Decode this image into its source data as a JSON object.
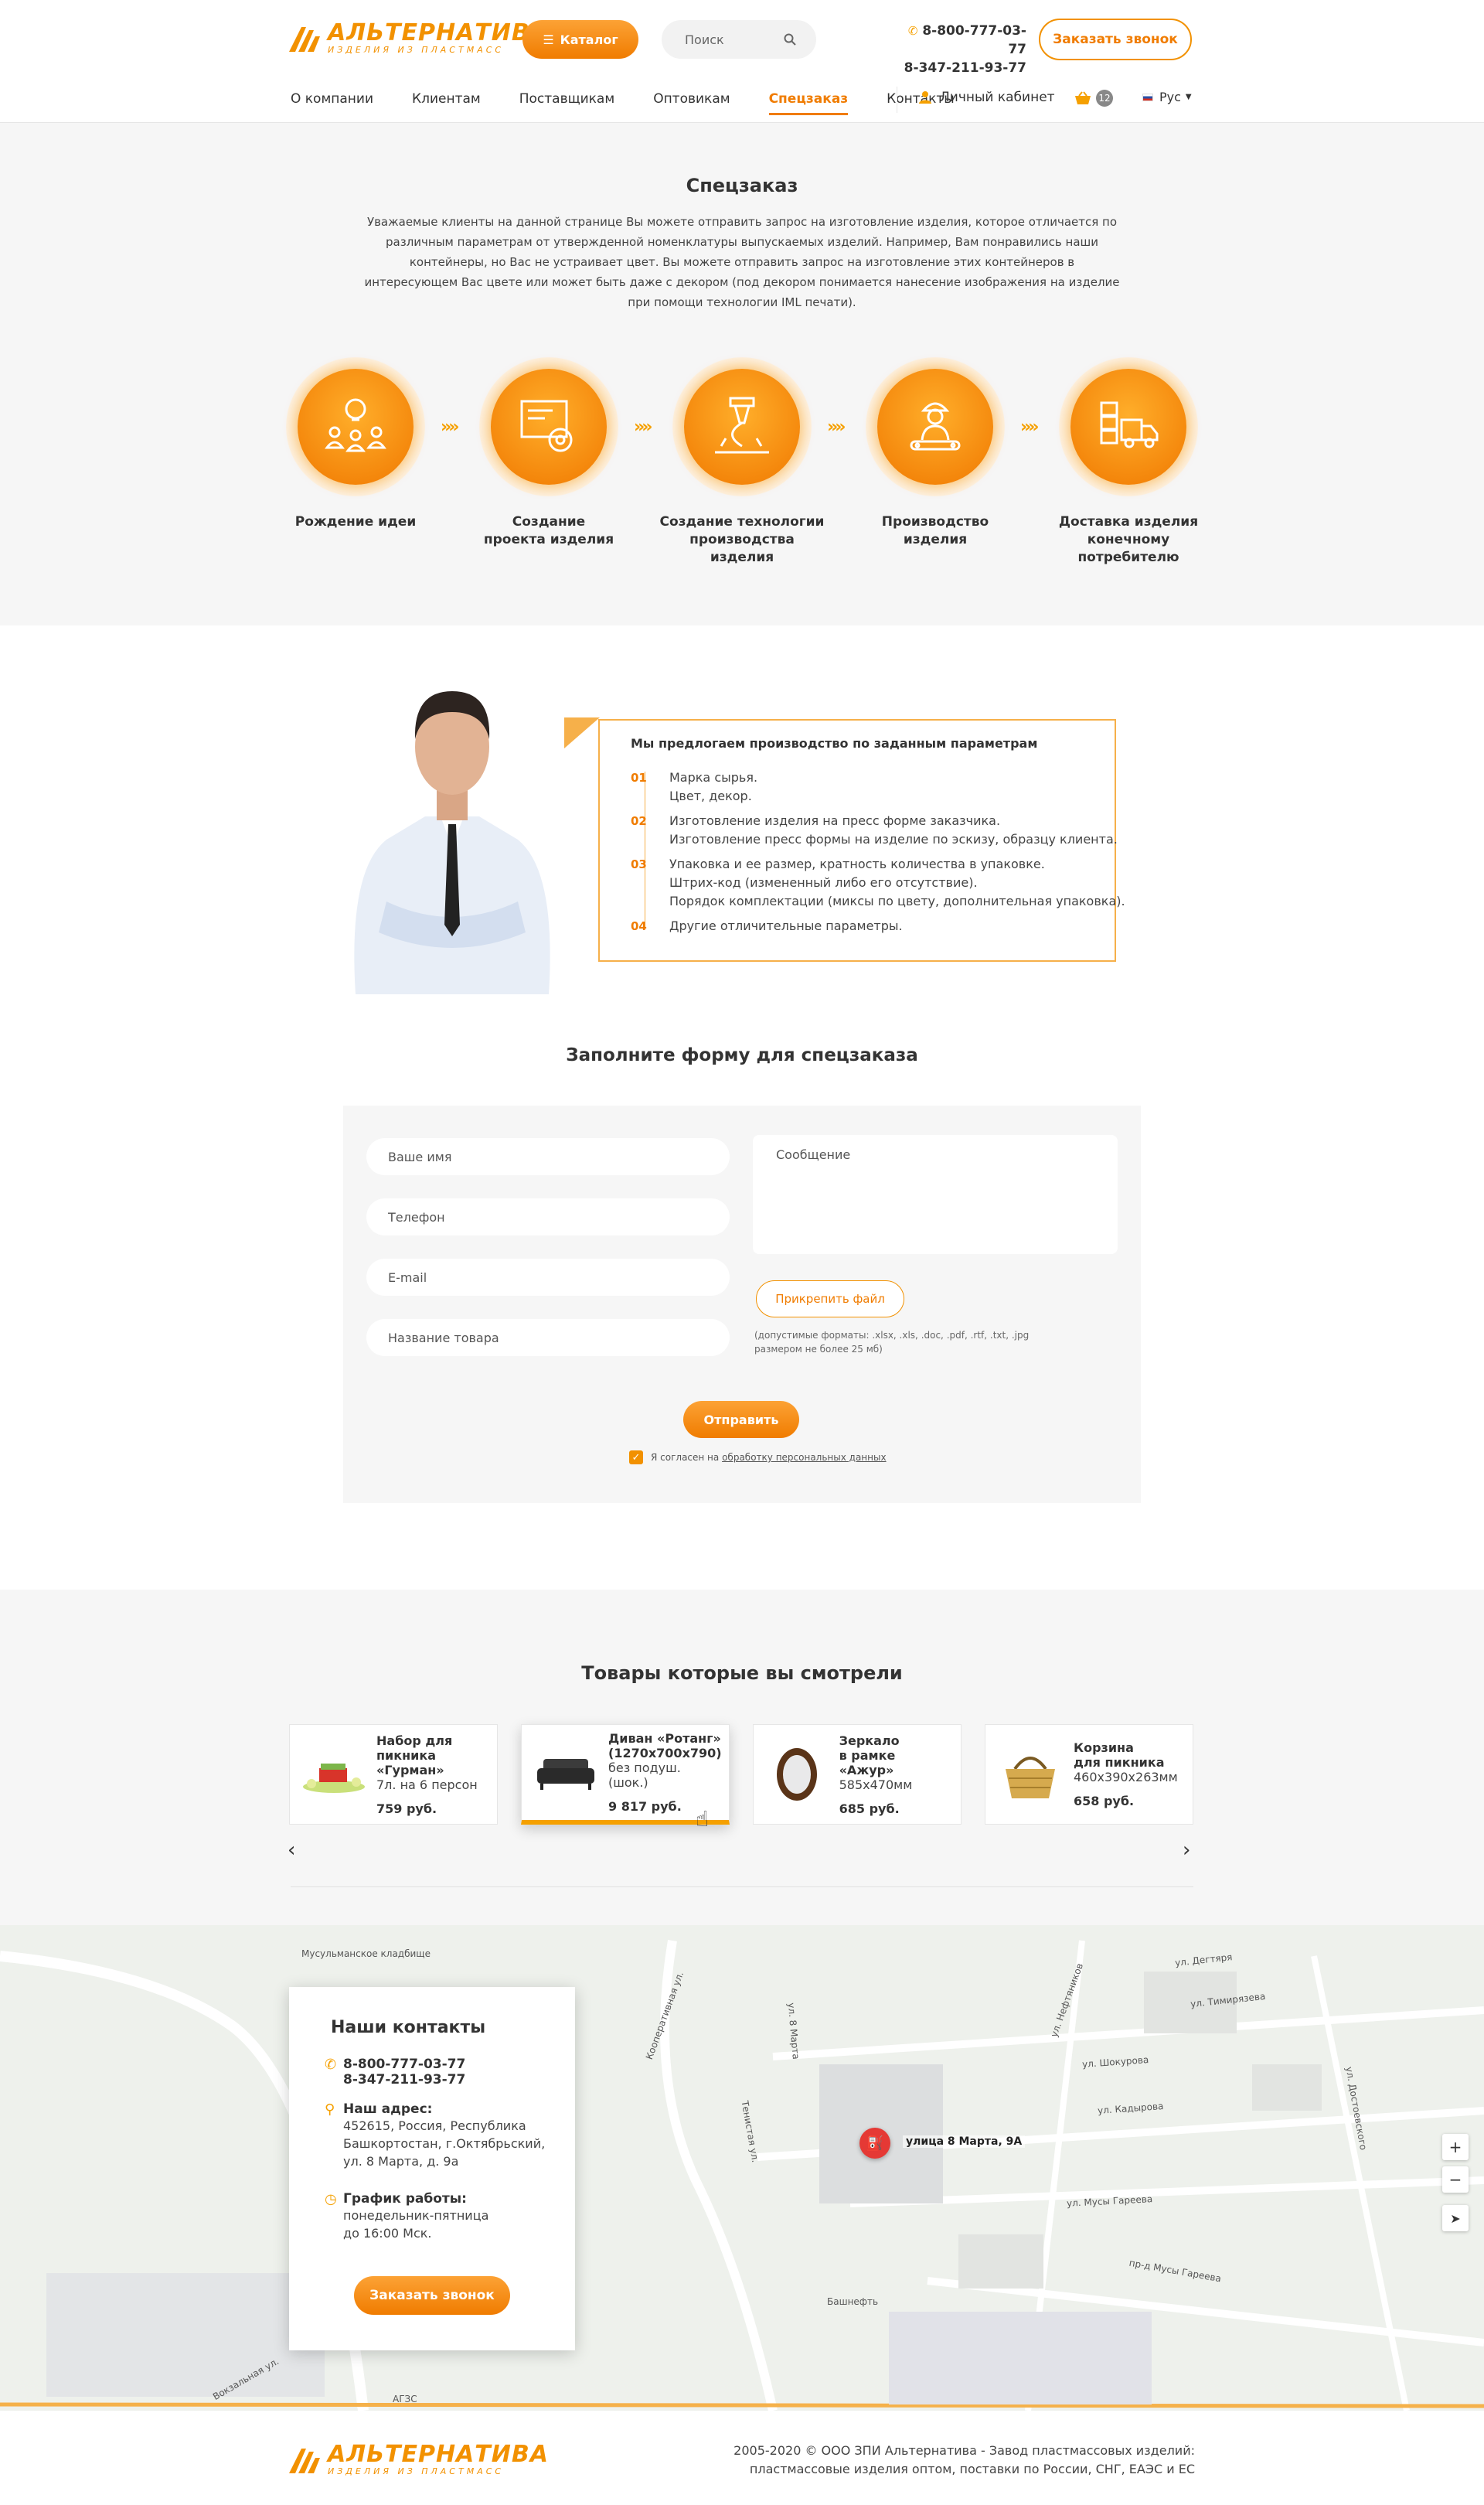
{
  "header": {
    "logo_name": "АЛЬТЕРНАТИВА",
    "logo_sub": "ИЗДЕЛИЯ ИЗ ПЛАСТМАСС",
    "catalog_label": "Каталог",
    "search_placeholder": "Поиск",
    "phone1": "8-800-777-03-77",
    "phone2": "8-347-211-93-77",
    "callback_label": "Заказать звонок"
  },
  "nav": {
    "items": [
      "О компании",
      "Клиентам",
      "Поставщикам",
      "Оптовикам",
      "Спецзаказ",
      "Контакты"
    ],
    "account_label": "Личный кабинет",
    "cart_count": "12",
    "lang": "Рус"
  },
  "intro": {
    "title": "Спецзаказ",
    "text": "Уважаемые клиенты на данной странице Вы можете отправить запрос на изготовление изделия, которое отличается по различным параметрам от утвержденной номенклатуры выпускаемых изделий. Например, Вам понравились наши контейнеры, но Вас не устраивает цвет. Вы можете отправить запрос на изготовление этих контейнеров в интересующем Вас цвете или может быть даже с декором (под декором понимается нанесение изображения на изделие при помощи технологии IML печати).",
    "steps": [
      {
        "line1": "Рождение идеи",
        "line2": "",
        "icon": "idea-icon"
      },
      {
        "line1": "Создание",
        "line2": "проекта изделия",
        "icon": "blueprint-gear-icon"
      },
      {
        "line1": "Создание технологии",
        "line2": "производства изделия",
        "icon": "technology-icon"
      },
      {
        "line1": "Производство изделия",
        "line2": "",
        "icon": "worker-icon"
      },
      {
        "line1": "Доставка изделия",
        "line2": "конечному потребителю",
        "icon": "delivery-truck-icon"
      }
    ]
  },
  "offer": {
    "title": "Мы предлогаем производство по заданным параметрам",
    "items": [
      {
        "num": "01",
        "lines": [
          "Марка сырья.",
          "Цвет, декор."
        ]
      },
      {
        "num": "02",
        "lines": [
          "Изготовление изделия на пресс форме заказчика.",
          "Изготовление пресс формы на изделие по эскизу, образцу клиента."
        ]
      },
      {
        "num": "03",
        "lines": [
          "Упаковка и ее размер, кратность количества в упаковке.",
          "Штрих-код (измененный либо его отсутствие).",
          "Порядок комплектации (миксы по цвету, дополнительная упаковка)."
        ]
      },
      {
        "num": "04",
        "lines": [
          "Другие отличительные параметры."
        ]
      }
    ]
  },
  "form": {
    "title": "Заполните форму для спецзаказа",
    "name_placeholder": "Ваше имя",
    "phone_placeholder": "Телефон",
    "email_placeholder": "E-mail",
    "product_placeholder": "Название товара",
    "message_placeholder": "Сообщение",
    "attach_label": "Прикрепить файл",
    "formats_line1": "(допустимые форматы: .xlsx, .xls, .doc, .pdf, .rtf, .txt, .jpg",
    "formats_line2": "размером не более 25 мб)",
    "submit_label": "Отправить",
    "consent_prefix": "Я согласен на ",
    "consent_link": "обработку персональных данных"
  },
  "viewed": {
    "title": "Товары которые вы смотрели",
    "products": [
      {
        "name1": "Набор для",
        "name2": "пикника «Гурман»",
        "desc1": "7л. на 6 персон",
        "desc2": "",
        "price": "759 руб.",
        "icon": "picnic-set-icon"
      },
      {
        "name1": "Диван «Ротанг»",
        "name2": "(1270x700x790)",
        "desc1": "без подуш. (шок.)",
        "desc2": "",
        "price": "9 817 руб.",
        "icon": "sofa-icon"
      },
      {
        "name1": "Зеркало",
        "name2": "в рамке «Ажур»",
        "desc1": "585x470мм",
        "desc2": "",
        "price": "685 руб.",
        "icon": "mirror-icon"
      },
      {
        "name1": "Корзина",
        "name2": "для пикника",
        "desc1": "460x390x263мм",
        "desc2": "",
        "price": "658 руб.",
        "icon": "basket-icon"
      }
    ]
  },
  "contacts": {
    "title": "Наши контакты",
    "phone1": "8-800-777-03-77",
    "phone2": "8-347-211-93-77",
    "address_label": "Наш адрес:",
    "address_lines": [
      "452615, Россия, Республика",
      "Башкортостан, г.Октябрьский,",
      "ул. 8 Марта, д. 9а"
    ],
    "hours_label": "График работы:",
    "hours_lines": [
      "понедельник-пятница",
      "до 16:00 Мск."
    ],
    "callback_label": "Заказать звонок"
  },
  "map": {
    "pin_label": "улица 8 Марта, 9А",
    "streets": [
      "Кооперативная ул.",
      "ул. 8 Марта",
      "ул. Дегтяря",
      "ул. Тимирязева",
      "ул. Нефтяников",
      "ул. Шокурова",
      "ул. Кадырова",
      "ул. Мусы Гареева",
      "пр-д Мусы Гареева",
      "ул. Достоевского",
      "Мусульманское кладбище",
      "Башнефть",
      "АГЗС",
      "Вокзальная ул.",
      "Тенистая ул."
    ]
  },
  "footer": {
    "line1": "2005-2020 © ООО ЗПИ Альтернатива - Завод пластмассовых изделий:",
    "line2": "пластмассовые изделия оптом, поставки по России, СНГ, ЕАЭС и ЕС"
  },
  "colors": {
    "accent": "#f29100",
    "accent_dark": "#f07c00",
    "bg_gray": "#f6f6f6"
  }
}
